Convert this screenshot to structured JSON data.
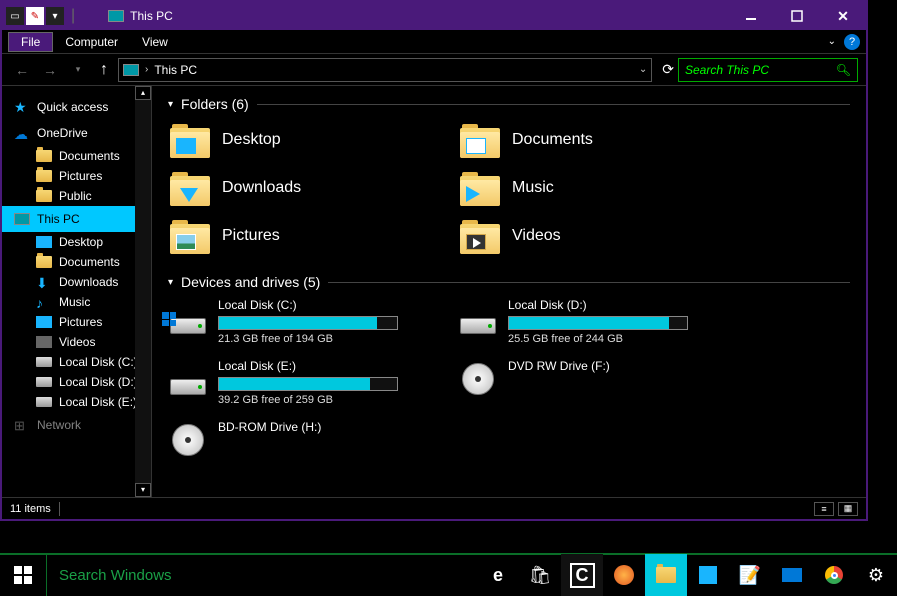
{
  "title": "This PC",
  "menus": {
    "file": "File",
    "computer": "Computer",
    "view": "View"
  },
  "address": {
    "location": "This PC"
  },
  "search": {
    "placeholder": "Search This PC"
  },
  "sidebar": {
    "quick_access": "Quick access",
    "onedrive": "OneDrive",
    "onedrive_items": [
      "Documents",
      "Pictures",
      "Public"
    ],
    "this_pc": "This PC",
    "this_pc_items": [
      "Desktop",
      "Documents",
      "Downloads",
      "Music",
      "Pictures",
      "Videos",
      "Local Disk (C:)",
      "Local Disk (D:)",
      "Local Disk (E:)"
    ],
    "network": "Network"
  },
  "sections": {
    "folders_label": "Folders (6)",
    "drives_label": "Devices and drives (5)"
  },
  "folders": [
    {
      "name": "Desktop"
    },
    {
      "name": "Documents"
    },
    {
      "name": "Downloads"
    },
    {
      "name": "Music"
    },
    {
      "name": "Pictures"
    },
    {
      "name": "Videos"
    }
  ],
  "drives": [
    {
      "name": "Local Disk (C:)",
      "free": "21.3 GB free of 194 GB",
      "fill": 89,
      "type": "hdd",
      "os": true
    },
    {
      "name": "Local Disk (D:)",
      "free": "25.5 GB free of 244 GB",
      "fill": 90,
      "type": "hdd"
    },
    {
      "name": "Local Disk (E:)",
      "free": "39.2 GB free of 259 GB",
      "fill": 85,
      "type": "hdd"
    },
    {
      "name": "DVD RW Drive (F:)",
      "type": "dvd"
    },
    {
      "name": "BD-ROM Drive (H:)",
      "type": "bd"
    }
  ],
  "status": {
    "items": "11 items"
  },
  "taskbar": {
    "search_placeholder": "Search Windows"
  }
}
